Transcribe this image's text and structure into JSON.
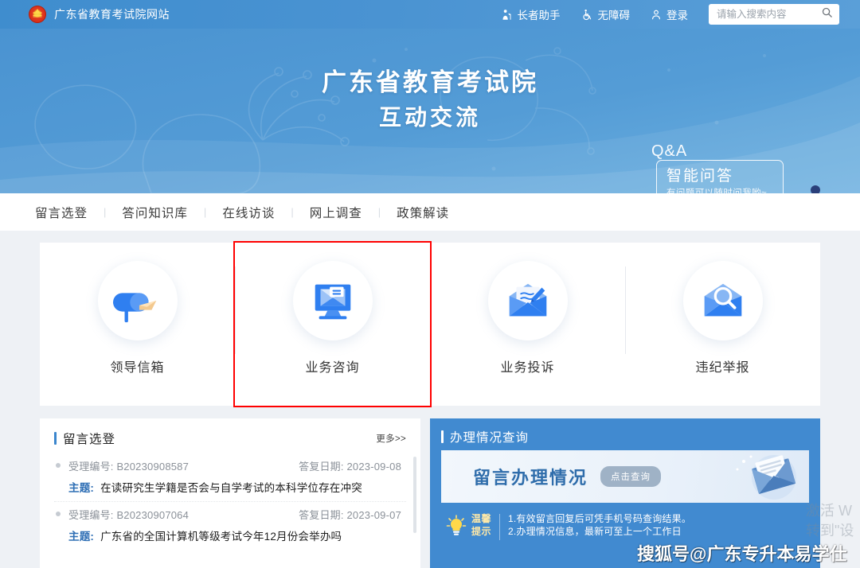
{
  "topbar": {
    "site_name": "广东省教育考试院网站",
    "emblem_icon": "national-emblem-icon",
    "links": [
      {
        "label": "长者助手",
        "icon": "elder-assistant-icon"
      },
      {
        "label": "无障碍",
        "icon": "accessibility-icon"
      },
      {
        "label": "登录",
        "icon": "user-icon"
      }
    ],
    "search": {
      "placeholder": "请输入搜索内容",
      "value": "",
      "icon": "search-icon"
    }
  },
  "banner": {
    "title": "广东省教育考试院",
    "subtitle": "互动交流",
    "qa_label": "Q&A",
    "qa_bubble_title": "智能问答",
    "qa_bubble_sub": "有问题可以随时问我哟~",
    "robot_icon": "robot-mascot-icon"
  },
  "nav": {
    "items": [
      {
        "label": "留言选登"
      },
      {
        "label": "答问知识库"
      },
      {
        "label": "在线访谈"
      },
      {
        "label": "网上调查"
      },
      {
        "label": "政策解读"
      }
    ],
    "separator": "|"
  },
  "cards": [
    {
      "label": "领导信箱",
      "icon": "mailbox-icon",
      "highlighted": false
    },
    {
      "label": "业务咨询",
      "icon": "monitor-envelope-icon",
      "highlighted": true
    },
    {
      "label": "业务投诉",
      "icon": "envelope-pen-icon",
      "highlighted": false
    },
    {
      "label": "违纪举报",
      "icon": "envelope-magnifier-icon",
      "highlighted": false
    }
  ],
  "highlight_color": "#ff0000",
  "accent_color": "#3b86cd",
  "panel_left": {
    "title": "留言选登",
    "more_label": "更多>>",
    "labels": {
      "case_no": "受理编号:",
      "reply_date": "答复日期:",
      "subject": "主题:"
    },
    "messages": [
      {
        "case_no": "B20230908587",
        "reply_date": "2023-09-08",
        "subject": "在读研究生学籍是否会与自学考试的本科学位存在冲突"
      },
      {
        "case_no": "B20230907064",
        "reply_date": "2023-09-07",
        "subject": "广东省的全国计算机等级考试今年12月份会举办吗"
      }
    ]
  },
  "panel_right": {
    "title": "办理情况查询",
    "query_banner_text": "留言办理情况",
    "query_button_label": "点击查询",
    "tips_label_line1": "温馨",
    "tips_label_line2": "提示",
    "tips": [
      "1.有效留言回复后可凭手机号码查询结果。",
      "2.办理情况信息，最新可至上一个工作日"
    ],
    "bulb_icon": "lightbulb-icon",
    "envelope_icon": "envelope-illustration-icon"
  },
  "watermarks": {
    "sohu": "搜狐号@广东专升本易学仕",
    "activate_line1": "激活 W",
    "activate_line2": "转到\"设"
  }
}
